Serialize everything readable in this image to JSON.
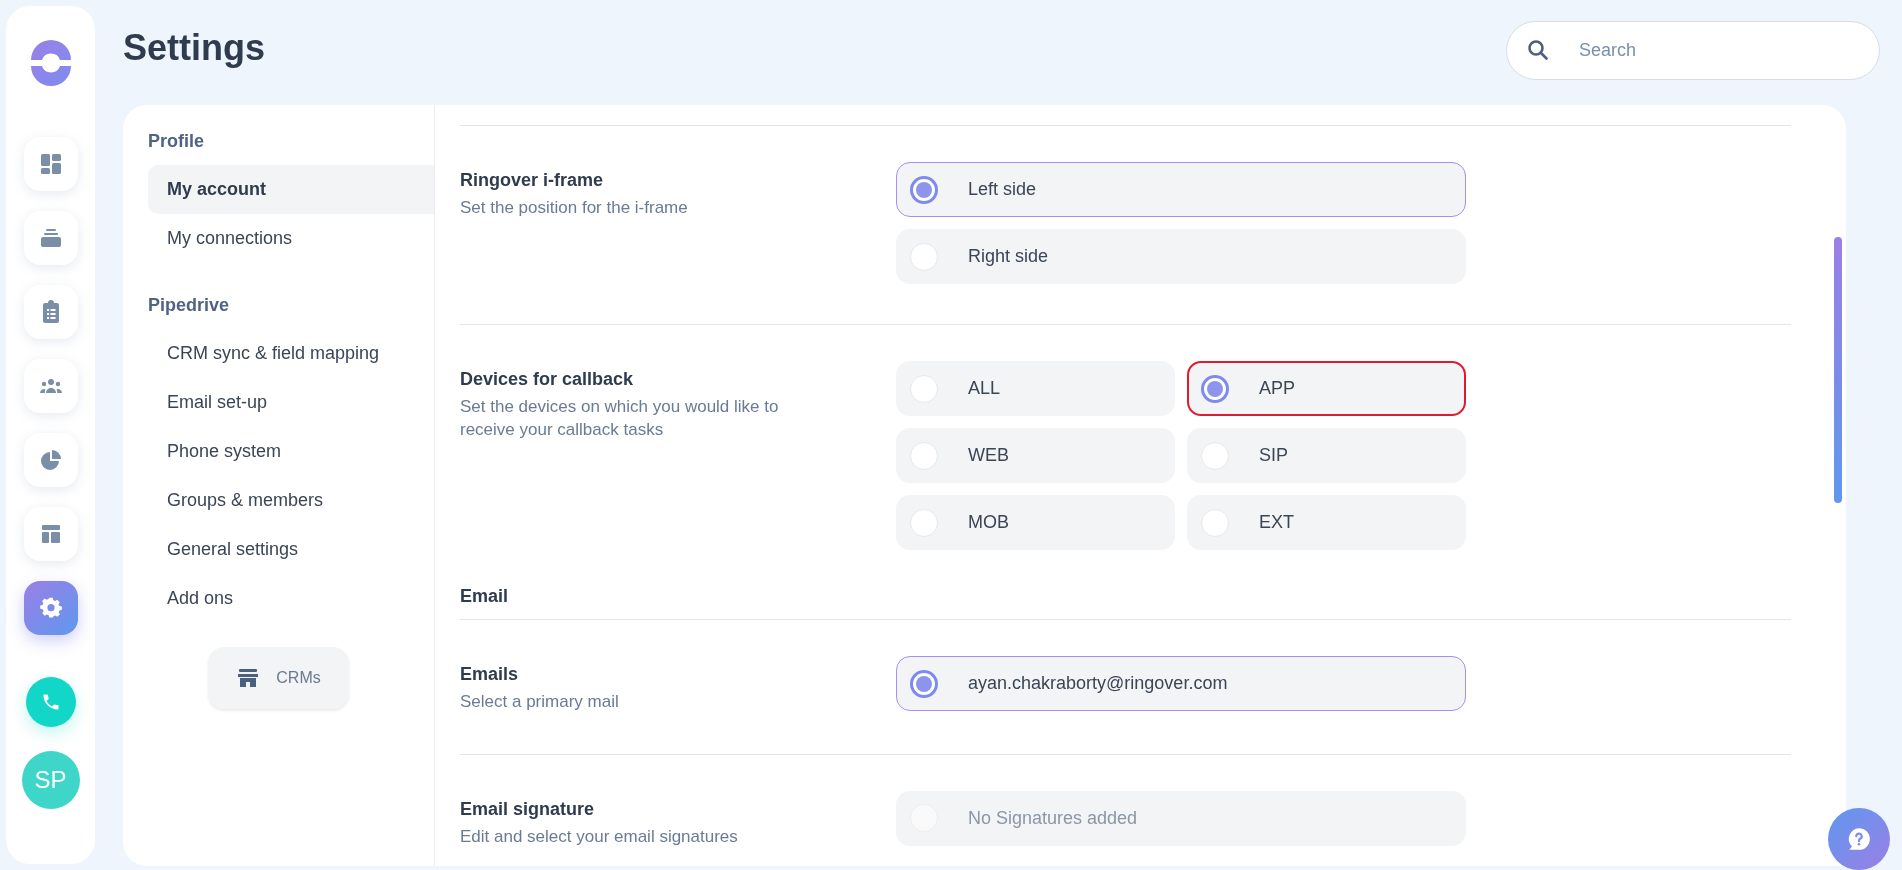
{
  "page_title": "Settings",
  "search": {
    "placeholder": "Search"
  },
  "sidebar": {
    "items": [
      {
        "selected": false
      },
      {
        "selected": false
      },
      {
        "selected": false
      },
      {
        "selected": false
      },
      {
        "selected": false
      },
      {
        "selected": false
      },
      {
        "selected": true
      }
    ],
    "avatar": "SP"
  },
  "settings_nav": {
    "sections": [
      {
        "title": "Profile",
        "items": [
          {
            "label": "My account",
            "selected": true
          },
          {
            "label": "My connections",
            "selected": false
          }
        ]
      },
      {
        "title": "Pipedrive",
        "items": [
          {
            "label": "CRM sync & field mapping",
            "selected": false
          },
          {
            "label": "Email set-up",
            "selected": false
          },
          {
            "label": "Phone system",
            "selected": false
          },
          {
            "label": "Groups & members",
            "selected": false
          },
          {
            "label": "General settings",
            "selected": false
          },
          {
            "label": "Add ons",
            "selected": false
          }
        ]
      }
    ],
    "crm_button": "CRMs"
  },
  "content": {
    "blocks": [
      {
        "kind": "list",
        "title": "Ringover i-frame",
        "description": "Set the position for the i-frame",
        "options": [
          {
            "label": "Left side",
            "selected": true,
            "focused": false,
            "disabled": false
          },
          {
            "label": "Right side",
            "selected": false,
            "focused": false,
            "disabled": false
          }
        ]
      },
      {
        "kind": "grid",
        "title": "Devices for callback",
        "description": "Set the devices on which you would like to receive your callback tasks",
        "options": [
          {
            "label": "ALL",
            "selected": false,
            "focused": false,
            "disabled": false
          },
          {
            "label": "APP",
            "selected": true,
            "focused": true,
            "disabled": false
          },
          {
            "label": "WEB",
            "selected": false,
            "focused": false,
            "disabled": false
          },
          {
            "label": "SIP",
            "selected": false,
            "focused": false,
            "disabled": false
          },
          {
            "label": "MOB",
            "selected": false,
            "focused": false,
            "disabled": false
          },
          {
            "label": "EXT",
            "selected": false,
            "focused": false,
            "disabled": false
          }
        ]
      },
      {
        "kind": "heading",
        "title": "Email"
      },
      {
        "kind": "list",
        "title": "Emails",
        "description": "Select a primary mail",
        "options": [
          {
            "label": "ayan.chakraborty@ringover.com",
            "selected": true,
            "focused": false,
            "disabled": false
          }
        ]
      },
      {
        "kind": "list",
        "title": "Email signature",
        "description": "Edit and select your email signatures",
        "options": [
          {
            "label": "No Signatures added",
            "selected": false,
            "focused": false,
            "disabled": true
          }
        ]
      }
    ]
  }
}
